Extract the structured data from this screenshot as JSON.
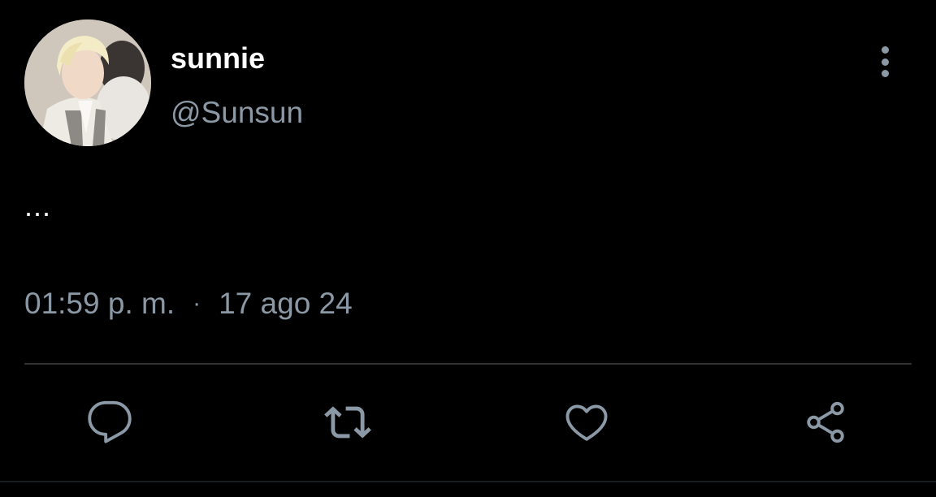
{
  "user": {
    "display_name": "sunnie",
    "handle": "@Sunsun",
    "avatar_icon": "profile-photo"
  },
  "tweet": {
    "text": "...",
    "time": "01:59 p. m.",
    "separator": "·",
    "date": "17 ago 24"
  },
  "actions": {
    "reply_icon": "chat-bubble-icon",
    "retweet_icon": "retweet-icon",
    "like_icon": "heart-icon",
    "share_icon": "share-icon"
  },
  "colors": {
    "background": "#000000",
    "primary_text": "#ffffff",
    "secondary_text": "#8b98a5",
    "divider": "#2f3336"
  }
}
